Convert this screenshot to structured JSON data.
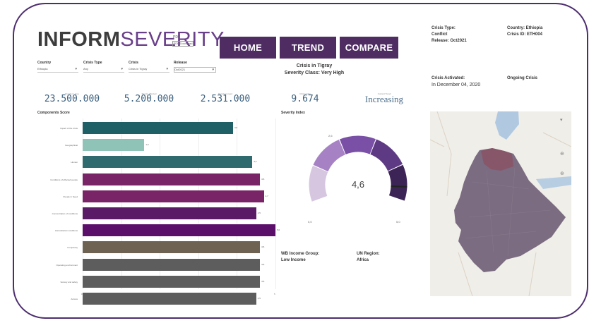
{
  "logo": {
    "part1": "INFORM",
    "part2": "SEVERITY",
    "pdf_label": "PDF",
    "pdf_button": "PDF Download"
  },
  "nav": {
    "home": "HOME",
    "trend": "TREND",
    "compare": "COMPARE"
  },
  "filters": {
    "country": {
      "label": "Country",
      "value": "Ethiopia"
    },
    "crisis_type": {
      "label": "Crisis Type",
      "value": "Any"
    },
    "crisis": {
      "label": "Crisis",
      "value": "Crisis in Tigray"
    },
    "release": {
      "label": "Release",
      "value": "Oct2021"
    }
  },
  "crisis_header": {
    "name": "Crisis in Tigray",
    "severity_class": "Severity Class: Very High"
  },
  "kpis": [
    {
      "label": "People in area",
      "value": "23.500.000"
    },
    {
      "label": "People affected",
      "value": "5.200.000"
    },
    {
      "label": "People in need",
      "value": "2.531.000"
    },
    {
      "label": "Crisis index",
      "value": "9.674"
    },
    {
      "label": "Current Trend",
      "value": "Increasing"
    }
  ],
  "components": {
    "title": "Components Score",
    "colors": {
      "teal_dark": "#1f5f66",
      "teal_light": "#8fc3b7",
      "teal_mid": "#2f6a6e",
      "magenta": "#7a2468",
      "purple": "#5a1a66",
      "purple_deep": "#5b0f6b",
      "brown": "#6e6252",
      "gray": "#5d5d5d"
    },
    "bars": [
      {
        "label": "Impact of the crisis",
        "value": 3.9,
        "value_text": "3,9",
        "color": "#1f5f66"
      },
      {
        "label": "Geographical",
        "value": 1.6,
        "value_text": "1,6",
        "color": "#8fc3b7"
      },
      {
        "label": "Human",
        "value": 4.4,
        "value_text": "4,4",
        "color": "#2f6a6e"
      },
      {
        "label": "Conditions of affected people",
        "value": 4.6,
        "value_text": "4,6",
        "color": "#7a2468"
      },
      {
        "label": "People in Need",
        "value": 4.7,
        "value_text": "4,7",
        "color": "#7a2468"
      },
      {
        "label": "Concentration of conditions",
        "value": 4.5,
        "value_text": "4,5",
        "color": "#5a1a66"
      },
      {
        "label": "Humanitarian conditions",
        "value": 5.0,
        "value_text": "5,0",
        "color": "#5b0f6b"
      },
      {
        "label": "Complexity",
        "value": 4.6,
        "value_text": "4,6",
        "color": "#6e6252"
      },
      {
        "label": "Operating environment",
        "value": 4.6,
        "value_text": "4,6",
        "color": "#5d5d5d"
      },
      {
        "label": "Society and safety",
        "value": 4.6,
        "value_text": "4,6",
        "color": "#5d5d5d"
      },
      {
        "label": "Access",
        "value": 4.5,
        "value_text": "4,5",
        "color": "#5d5d5d"
      }
    ],
    "axis_ticks": [
      "0",
      "1",
      "2",
      "3",
      "4",
      "5"
    ]
  },
  "severity_index": {
    "title": "Severity Index",
    "value": 4.6,
    "value_text": "4,6",
    "min_text": "0,0",
    "max_text": "5,0",
    "marker_text": "2,6"
  },
  "bottom_info": {
    "wb_label": "WB Income Group:",
    "wb_value": "Low Income",
    "un_label": "UN Region:",
    "un_value": "Africa"
  },
  "side": {
    "crisis_type_label": "Crisis Type:",
    "crisis_type_value": "Conflict",
    "release": "Release: Oct2021",
    "country": "Country: Ethiopia",
    "crisis_id": "Crisis ID: ETH004",
    "activated_label": "Crisis Activated:",
    "activated_value": "In December 04, 2020",
    "status": "Ongoing Crisis"
  }
}
